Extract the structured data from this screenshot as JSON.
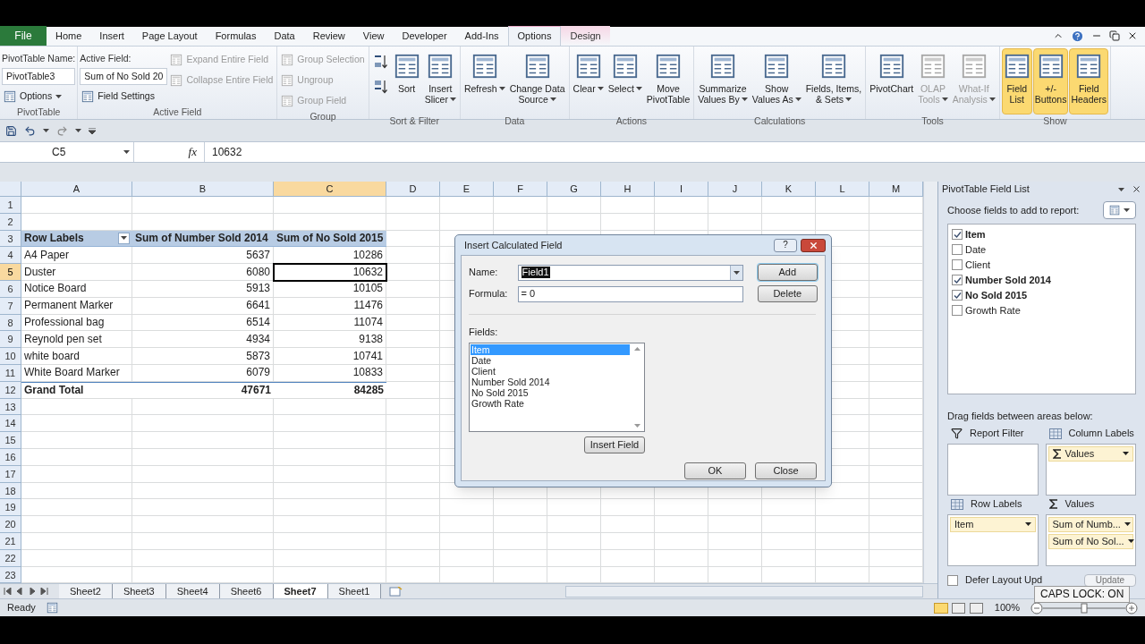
{
  "file_tab": "File",
  "tabs": [
    {
      "label": "Home",
      "selected": false,
      "contextual": false
    },
    {
      "label": "Insert",
      "selected": false,
      "contextual": false
    },
    {
      "label": "Page Layout",
      "selected": false,
      "contextual": false
    },
    {
      "label": "Formulas",
      "selected": false,
      "contextual": false
    },
    {
      "label": "Data",
      "selected": false,
      "contextual": false
    },
    {
      "label": "Review",
      "selected": false,
      "contextual": false
    },
    {
      "label": "View",
      "selected": false,
      "contextual": false
    },
    {
      "label": "Developer",
      "selected": false,
      "contextual": false
    },
    {
      "label": "Add-Ins",
      "selected": false,
      "contextual": false
    },
    {
      "label": "Options",
      "selected": true,
      "contextual": true
    },
    {
      "label": "Design",
      "selected": false,
      "contextual": true
    }
  ],
  "ribbon_groups": [
    {
      "title": "PivotTable",
      "items": [
        {
          "kind": "caption",
          "label": "PivotTable Name:"
        },
        {
          "kind": "field",
          "label": "PivotTable3"
        },
        {
          "kind": "small",
          "label": "Options",
          "dropdown": true,
          "disabled": false
        }
      ]
    },
    {
      "title": "Active Field",
      "items": [
        {
          "kind": "caption",
          "label": "Active Field:"
        },
        {
          "kind": "field",
          "label": "Sum of No Sold 20"
        },
        {
          "kind": "small",
          "label": "Field Settings",
          "dropdown": false,
          "disabled": false
        },
        {
          "kind": "small",
          "label": "Expand Entire Field",
          "dropdown": false,
          "disabled": true
        },
        {
          "kind": "small",
          "label": "Collapse Entire Field",
          "dropdown": false,
          "disabled": true
        }
      ]
    },
    {
      "title": "Group",
      "items": [
        {
          "kind": "small",
          "label": "Group Selection",
          "dropdown": false,
          "disabled": true
        },
        {
          "kind": "small",
          "label": "Ungroup",
          "dropdown": false,
          "disabled": true
        },
        {
          "kind": "small",
          "label": "Group Field",
          "dropdown": false,
          "disabled": true
        }
      ]
    },
    {
      "title": "Sort & Filter",
      "items": [
        {
          "kind": "icon"
        },
        {
          "kind": "icon"
        },
        {
          "kind": "large",
          "lines": [
            "Sort"
          ],
          "dropdown": false,
          "disabled": false,
          "selected": false
        },
        {
          "kind": "large",
          "lines": [
            "Insert",
            "Slicer"
          ],
          "dropdown": true,
          "disabled": false,
          "selected": false
        }
      ]
    },
    {
      "title": "Data",
      "items": [
        {
          "kind": "large",
          "lines": [
            "Refresh"
          ],
          "dropdown": true,
          "disabled": false,
          "selected": false
        },
        {
          "kind": "large",
          "lines": [
            "Change Data",
            "Source"
          ],
          "dropdown": true,
          "disabled": false,
          "selected": false
        }
      ]
    },
    {
      "title": "Actions",
      "items": [
        {
          "kind": "large",
          "lines": [
            "Clear"
          ],
          "dropdown": true,
          "disabled": false,
          "selected": false
        },
        {
          "kind": "large",
          "lines": [
            "Select"
          ],
          "dropdown": true,
          "disabled": false,
          "selected": false
        },
        {
          "kind": "large",
          "lines": [
            "Move",
            "PivotTable"
          ],
          "dropdown": false,
          "disabled": false,
          "selected": false
        }
      ]
    },
    {
      "title": "Calculations",
      "items": [
        {
          "kind": "large",
          "lines": [
            "Summarize",
            "Values By"
          ],
          "dropdown": true,
          "disabled": false,
          "selected": false
        },
        {
          "kind": "large",
          "lines": [
            "Show",
            "Values As"
          ],
          "dropdown": true,
          "disabled": false,
          "selected": false
        },
        {
          "kind": "large",
          "lines": [
            "Fields, Items,",
            "& Sets"
          ],
          "dropdown": true,
          "disabled": false,
          "selected": false
        }
      ]
    },
    {
      "title": "Tools",
      "items": [
        {
          "kind": "large",
          "lines": [
            "PivotChart"
          ],
          "dropdown": false,
          "disabled": false,
          "selected": false
        },
        {
          "kind": "large",
          "lines": [
            "OLAP",
            "Tools"
          ],
          "dropdown": true,
          "disabled": true,
          "selected": false
        },
        {
          "kind": "large",
          "lines": [
            "What-If",
            "Analysis"
          ],
          "dropdown": true,
          "disabled": true,
          "selected": false
        }
      ]
    },
    {
      "title": "Show",
      "items": [
        {
          "kind": "large",
          "lines": [
            "Field",
            "List"
          ],
          "dropdown": false,
          "disabled": false,
          "selected": true
        },
        {
          "kind": "large",
          "lines": [
            "+/-",
            "Buttons"
          ],
          "dropdown": false,
          "disabled": false,
          "selected": true
        },
        {
          "kind": "large",
          "lines": [
            "Field",
            "Headers"
          ],
          "dropdown": false,
          "disabled": false,
          "selected": true
        }
      ]
    }
  ],
  "formula_bar": {
    "name_box": "C5",
    "fx": "fx",
    "value": "10632"
  },
  "sheet": {
    "columns": [
      {
        "label": "A",
        "selected": false
      },
      {
        "label": "B",
        "selected": false
      },
      {
        "label": "C",
        "selected": true
      },
      {
        "label": "D",
        "selected": false
      },
      {
        "label": "E",
        "selected": false
      },
      {
        "label": "F",
        "selected": false
      },
      {
        "label": "G",
        "selected": false
      },
      {
        "label": "H",
        "selected": false
      },
      {
        "label": "I",
        "selected": false
      },
      {
        "label": "J",
        "selected": false
      },
      {
        "label": "K",
        "selected": false
      },
      {
        "label": "L",
        "selected": false
      },
      {
        "label": "M",
        "selected": false
      }
    ],
    "rows": [
      {
        "number": "1",
        "selected": false,
        "kind": "blank"
      },
      {
        "number": "2",
        "selected": false,
        "kind": "blank"
      },
      {
        "number": "3",
        "selected": false,
        "kind": "header",
        "cells": [
          "Row Labels",
          "Sum of Number Sold 2014",
          "Sum of No Sold 2015"
        ]
      },
      {
        "number": "4",
        "selected": false,
        "kind": "item",
        "cells": [
          "A4 Paper",
          "5637",
          "10286"
        ]
      },
      {
        "number": "5",
        "selected": true,
        "kind": "item",
        "cells": [
          "Duster",
          "6080",
          "10632"
        ]
      },
      {
        "number": "6",
        "selected": false,
        "kind": "item",
        "cells": [
          "Notice Board",
          "5913",
          "10105"
        ]
      },
      {
        "number": "7",
        "selected": false,
        "kind": "item",
        "cells": [
          "Permanent Marker",
          "6641",
          "11476"
        ]
      },
      {
        "number": "8",
        "selected": false,
        "kind": "item",
        "cells": [
          "Professional bag",
          "6514",
          "11074"
        ]
      },
      {
        "number": "9",
        "selected": false,
        "kind": "item",
        "cells": [
          "Reynold pen set",
          "4934",
          "9138"
        ]
      },
      {
        "number": "10",
        "selected": false,
        "kind": "item",
        "cells": [
          "white board",
          "5873",
          "10741"
        ]
      },
      {
        "number": "11",
        "selected": false,
        "kind": "item",
        "cells": [
          "White Board Marker",
          "6079",
          "10833"
        ]
      },
      {
        "number": "12",
        "selected": false,
        "kind": "total",
        "cells": [
          "Grand Total",
          "47671",
          "84285"
        ]
      },
      {
        "number": "13",
        "selected": false,
        "kind": "blank"
      },
      {
        "number": "14",
        "selected": false,
        "kind": "blank"
      },
      {
        "number": "15",
        "selected": false,
        "kind": "blank"
      },
      {
        "number": "16",
        "selected": false,
        "kind": "blank"
      },
      {
        "number": "17",
        "selected": false,
        "kind": "blank"
      },
      {
        "number": "18",
        "selected": false,
        "kind": "blank"
      },
      {
        "number": "19",
        "selected": false,
        "kind": "blank"
      },
      {
        "number": "20",
        "selected": false,
        "kind": "blank"
      },
      {
        "number": "21",
        "selected": false,
        "kind": "blank"
      },
      {
        "number": "22",
        "selected": false,
        "kind": "blank"
      },
      {
        "number": "23",
        "selected": false,
        "kind": "blank"
      }
    ]
  },
  "sheet_tabs": [
    {
      "label": "Sheet2",
      "selected": false
    },
    {
      "label": "Sheet3",
      "selected": false
    },
    {
      "label": "Sheet4",
      "selected": false
    },
    {
      "label": "Sheet6",
      "selected": false
    },
    {
      "label": "Sheet7",
      "selected": true
    },
    {
      "label": "Sheet1",
      "selected": false
    }
  ],
  "status_bar": {
    "status": "Ready",
    "zoom": "100%",
    "zoom_slider": {
      "level": 0.5
    }
  },
  "caps_lock": "CAPS LOCK: ON",
  "dialog": {
    "title": "Insert Calculated Field",
    "help": "?",
    "name_label": "Name:",
    "name_value": "Field1",
    "formula_label": "Formula:",
    "formula_value": "= 0",
    "fields_label": "Fields:",
    "fields": [
      {
        "label": "Item",
        "selected": true
      },
      {
        "label": "Date",
        "selected": false
      },
      {
        "label": "Client",
        "selected": false
      },
      {
        "label": "Number Sold 2014",
        "selected": false
      },
      {
        "label": "No Sold 2015",
        "selected": false
      },
      {
        "label": "Growth Rate",
        "selected": false
      }
    ],
    "buttons": {
      "add": "Add",
      "delete": "Delete",
      "insert_field": "Insert Field",
      "ok": "OK",
      "close": "Close"
    }
  },
  "field_list": {
    "title": "PivotTable Field List",
    "choose_label": "Choose fields to add to report:",
    "fields": [
      {
        "label": "Item",
        "checked": true
      },
      {
        "label": "Date",
        "checked": false
      },
      {
        "label": "Client",
        "checked": false
      },
      {
        "label": "Number Sold 2014",
        "checked": true
      },
      {
        "label": "No Sold 2015",
        "checked": true
      },
      {
        "label": "Growth Rate",
        "checked": false
      }
    ],
    "drag_label": "Drag fields between areas below:",
    "areas": [
      {
        "kind": "filter",
        "title": "Report Filter"
      },
      {
        "kind": "columns",
        "title": "Column Labels",
        "items": [
          {
            "label": "Values",
            "sigma": true
          }
        ]
      },
      {
        "kind": "rows",
        "title": "Row Labels",
        "items": [
          {
            "label": "Item",
            "sigma": false
          }
        ]
      },
      {
        "kind": "values",
        "title": "Values",
        "items": [
          {
            "label": "Sum of Numb...",
            "sigma": false
          },
          {
            "label": "Sum of No Sol...",
            "sigma": false
          }
        ]
      }
    ],
    "defer": {
      "label": "Defer Layout Upd",
      "checked": false
    },
    "update": "Update"
  }
}
